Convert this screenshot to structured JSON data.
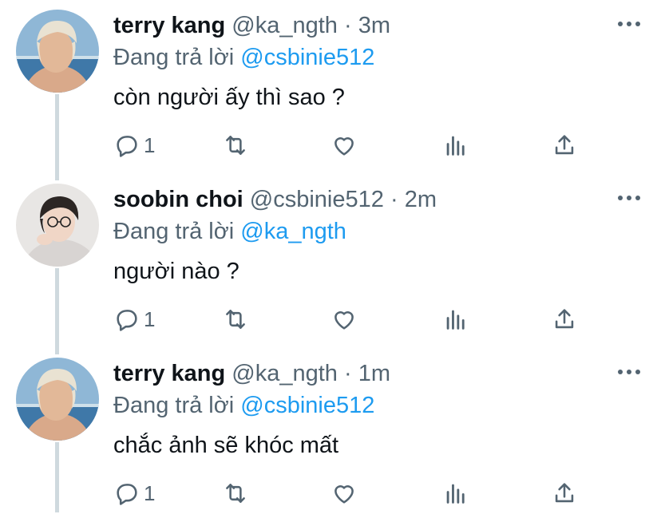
{
  "tweets": [
    {
      "name": "terry kang",
      "handle": "@ka_ngth",
      "separator": "·",
      "time": "3m",
      "reply_prefix": "Đang trả lời",
      "reply_to": "@csbinie512",
      "text": "còn người ấy thì sao ?",
      "reply_count": "1",
      "avatar": "avatar-terry"
    },
    {
      "name": "soobin choi",
      "handle": "@csbinie512",
      "separator": "·",
      "time": "2m",
      "reply_prefix": "Đang trả lời",
      "reply_to": "@ka_ngth",
      "text": "người nào ?",
      "reply_count": "1",
      "avatar": "avatar-soobin"
    },
    {
      "name": "terry kang",
      "handle": "@ka_ngth",
      "separator": "·",
      "time": "1m",
      "reply_prefix": "Đang trả lời",
      "reply_to": "@csbinie512",
      "text": "chắc ảnh sẽ khóc mất",
      "reply_count": "1",
      "avatar": "avatar-terry"
    }
  ],
  "icons": {
    "reply": "reply-icon",
    "retweet": "retweet-icon",
    "like": "heart-icon",
    "analytics": "analytics-icon",
    "share": "share-icon",
    "more": "more-icon"
  },
  "colors": {
    "text": "#0f1419",
    "secondary": "#536471",
    "link": "#1d9bf0",
    "thread_line": "#cfd9de"
  }
}
